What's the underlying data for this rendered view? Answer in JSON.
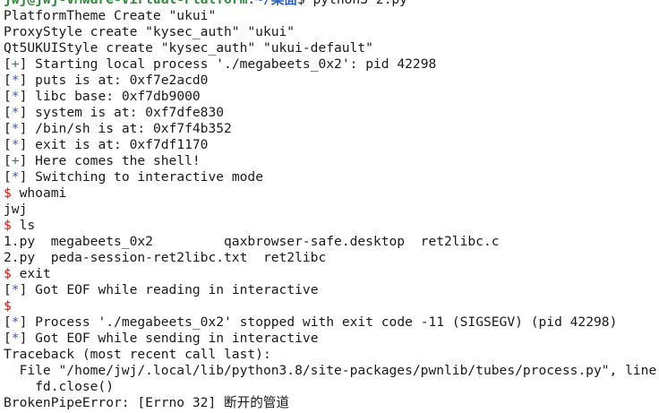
{
  "colors": {
    "background": "#ffffff",
    "text": "#1a1a1a",
    "prompt_user": "#2e8b3a",
    "prompt_path": "#2b5fc7",
    "info_star": "#2b5fc7",
    "success_plus": "#2e8b3a",
    "shell_dollar": "#c8201a"
  },
  "prompt": {
    "user_host": "jwj@jwj-VMware-Virtual-Platform",
    "path": ":~/桌面",
    "symbol": "$",
    "command": " python3 2.py"
  },
  "lines": {
    "l1": "PlatformTheme Create \"ukui\"",
    "l2": "ProxyStyle create \"kysec_auth\" \"ukui\"",
    "l3": "Qt5UKUIStyle create \"kysec_auth\" \"ukui-default\"",
    "l4_tag": "+",
    "l4": " Starting local process './megabeets_0x2': pid 42298",
    "l5_tag": "*",
    "l5": " puts is at: 0xf7e2acd0",
    "l6_tag": "*",
    "l6": " libc base: 0xf7db9000",
    "l7_tag": "*",
    "l7": " system is at: 0xf7dfe830",
    "l8_tag": "*",
    "l8": " /bin/sh is at: 0xf7f4b352",
    "l9_tag": "*",
    "l9": " exit is at: 0xf7df1170",
    "l10_tag": "+",
    "l10": " Here comes the shell!",
    "l11_tag": "*",
    "l11": " Switching to interactive mode",
    "l12_dollar": "$",
    "l12": " whoami",
    "l13": "jwj",
    "l14_dollar": "$",
    "l14": " ls",
    "l15": "1.py  megabeets_0x2         qaxbrowser-safe.desktop  ret2libc.c",
    "l16": "2.py  peda-session-ret2libc.txt  ret2libc",
    "l17_dollar": "$",
    "l17": " exit",
    "l18_tag": "*",
    "l18": " Got EOF while reading in interactive",
    "l19_dollar": "$",
    "l20_tag": "*",
    "l20": " Process './megabeets_0x2' stopped with exit code -11 (SIGSEGV) (pid 42298)",
    "l21_tag": "*",
    "l21": " Got EOF while sending in interactive",
    "l22": "Traceback (most recent call last):",
    "l23": "  File \"/home/jwj/.local/lib/python3.8/site-packages/pwnlib/tubes/process.py\", line",
    "l24": "    fd.close()",
    "l25": "BrokenPipeError: [Errno 32] 断开的管道"
  }
}
